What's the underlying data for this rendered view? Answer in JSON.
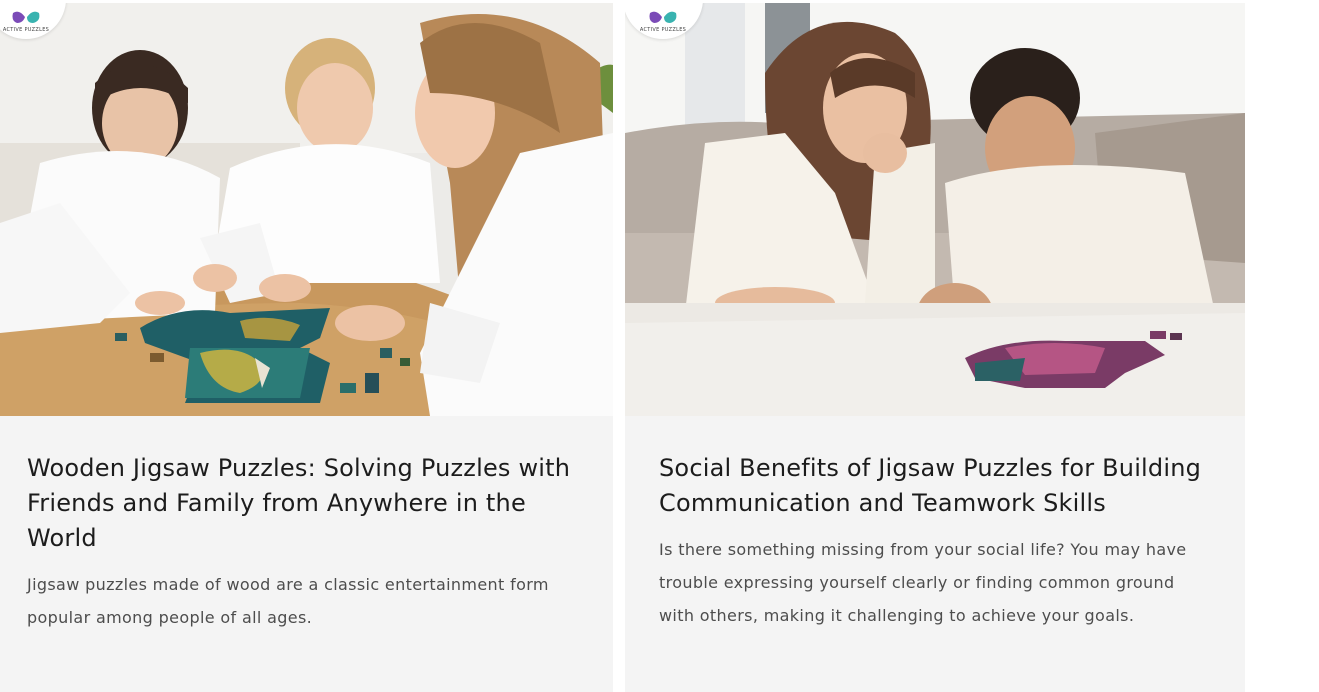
{
  "brand": {
    "logo_text": "ACTIVE PUZZLES",
    "colors": {
      "logo_purple": "#7b4bb7",
      "logo_teal": "#39b3b0",
      "card_background": "#f4f4f4",
      "title_text": "#1c1c1c",
      "excerpt_text": "#4d4d4d"
    }
  },
  "articles": [
    {
      "title": "Wooden Jigsaw Puzzles: Solving Puzzles with Friends and Family from Anywhere in the World",
      "excerpt": "Jigsaw puzzles made of wood are a classic entertainment form popular among people of all ages.",
      "image_icon": "photo-three-girls-solving-puzzle"
    },
    {
      "title": "Social Benefits of Jigsaw Puzzles for Building Communication and Teamwork Skills",
      "excerpt": "Is there something missing from your social life? You may have trouble expressing yourself clearly or finding common ground with others, making it challenging to achieve your goals.",
      "image_icon": "photo-mother-and-son-solving-puzzle"
    }
  ]
}
